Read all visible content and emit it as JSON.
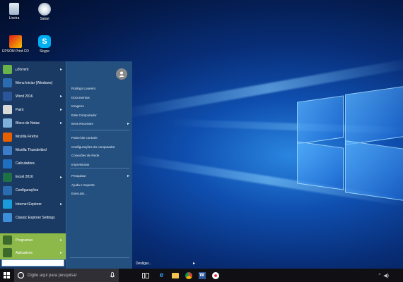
{
  "desktop": {
    "icons": [
      {
        "label": "Lixeira"
      },
      {
        "label": "Safari"
      },
      {
        "label": "EPSON Print CD"
      },
      {
        "label": "Skype"
      }
    ]
  },
  "start_menu": {
    "left_items": [
      {
        "label": "µTorrent",
        "icon": "utorrent-icon",
        "color": "#6ab24a"
      },
      {
        "label": "Menu Iniciar (Windows)",
        "icon": "start-menu-icon",
        "color": "#2b6cb0"
      },
      {
        "label": "Word 2016",
        "icon": "word-icon",
        "color": "#2a5599"
      },
      {
        "label": "Paint",
        "icon": "paint-icon",
        "color": "#d9d9d9"
      },
      {
        "label": "Bloco de Notas",
        "icon": "notepad-icon",
        "color": "#7fb0da"
      },
      {
        "label": "Mozilla Firefox",
        "icon": "firefox-icon",
        "color": "#e66000"
      },
      {
        "label": "Mozilla Thunderbird",
        "icon": "thunderbird-icon",
        "color": "#3d7cc9"
      },
      {
        "label": "Calculadora",
        "icon": "calculator-icon",
        "color": "#1f6fbf"
      },
      {
        "label": "Excel 2016",
        "icon": "excel-icon",
        "color": "#1e7145"
      },
      {
        "label": "Configurações",
        "icon": "settings-icon",
        "color": "#2b6cb0"
      },
      {
        "label": "Internet Explorer",
        "icon": "internet-explorer-icon",
        "color": "#1a9bdc"
      },
      {
        "label": "Classic Explorer Settings",
        "icon": "classic-explorer-icon",
        "color": "#3d8fd9"
      }
    ],
    "bottom_items": [
      {
        "label": "Programas",
        "icon": "programs-icon"
      },
      {
        "label": "Aplicativos",
        "icon": "apps-icon"
      }
    ],
    "right_group1": [
      "Rodrigo Loureiro",
      "Documentos",
      "Imagens",
      "Este Computador",
      "Itens Recentes"
    ],
    "right_group2": [
      "Painel de controle",
      "Configurações do computador",
      "Conexões de Rede",
      "Impressoras"
    ],
    "right_group3": [
      "Pesquisar",
      "Ajuda e Suporte",
      "Executar..."
    ],
    "search_placeholder": "",
    "shutdown_label": "Desligar..."
  },
  "taskbar": {
    "search_placeholder": "Digite aqui para pesquisar",
    "colors": {
      "bar": "#101014",
      "accent": "#8db94a"
    }
  }
}
